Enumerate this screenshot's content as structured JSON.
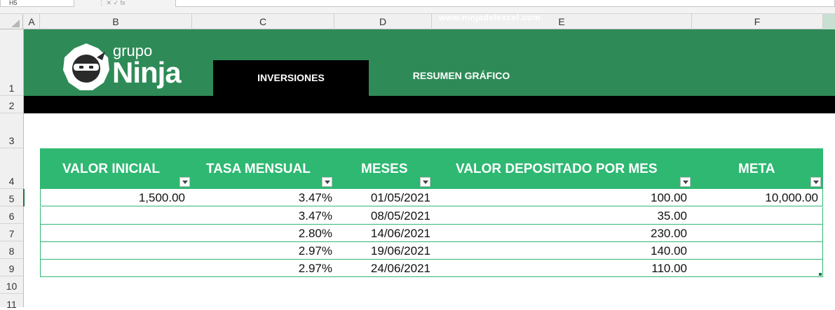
{
  "formula_bar": {
    "name_box": "H5"
  },
  "columns": [
    "A",
    "B",
    "C",
    "D",
    "E",
    "F"
  ],
  "rows": [
    "1",
    "2",
    "3",
    "4",
    "5",
    "6",
    "7",
    "8",
    "9",
    "10",
    "11"
  ],
  "banner": {
    "watermark": "www.ninjadelexcel.com",
    "logo_top": "grupo",
    "logo_main": "Ninja",
    "tab_active": "INVERSIONES",
    "tab_other": "RESUMEN GRÁFICO"
  },
  "table": {
    "headers": [
      "VALOR INICIAL",
      "TASA MENSUAL",
      "MESES",
      "VALOR DEPOSITADO POR MES",
      "META"
    ],
    "rows": [
      [
        "1,500.00",
        "3.47%",
        "01/05/2021",
        "100.00",
        "10,000.00"
      ],
      [
        "",
        "3.47%",
        "08/05/2021",
        "35.00",
        ""
      ],
      [
        "",
        "2.80%",
        "14/06/2021",
        "230.00",
        ""
      ],
      [
        "",
        "2.97%",
        "19/06/2021",
        "140.00",
        ""
      ],
      [
        "",
        "2.97%",
        "24/06/2021",
        "110.00",
        ""
      ]
    ]
  },
  "colors": {
    "banner": "#2e8b57",
    "table_header": "#2eb872",
    "dark": "#000000"
  },
  "icons": [
    "ninja-logo-icon",
    "filter-dropdown-icon"
  ]
}
